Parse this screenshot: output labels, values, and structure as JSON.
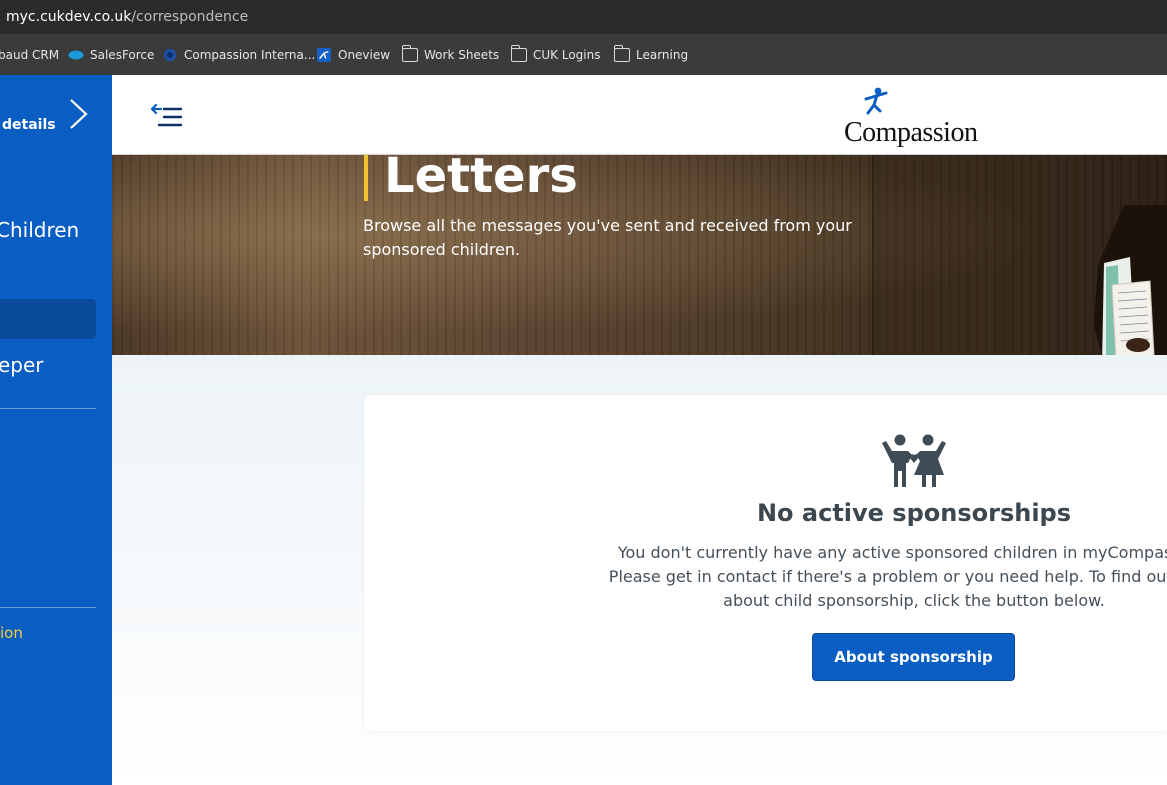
{
  "browser": {
    "url_host": "myc.cukdev.co.uk",
    "url_path": "/correspondence",
    "bookmarks": [
      {
        "label": "baud CRM",
        "icon": "none"
      },
      {
        "label": "SalesForce",
        "icon": "salesforce-icon"
      },
      {
        "label": "Compassion Interna...",
        "icon": "compassion-circle-icon"
      },
      {
        "label": "Oneview",
        "icon": "oneview-icon"
      },
      {
        "label": "Work Sheets",
        "icon": "folder-icon"
      },
      {
        "label": "CUK Logins",
        "icon": "folder-icon"
      },
      {
        "label": "Learning",
        "icon": "folder-icon"
      }
    ]
  },
  "sidebar": {
    "details_label": "details",
    "children_label": "Children",
    "keeper_label": "eper",
    "yellow_label": "ion"
  },
  "header": {
    "logo_text": "Compassion"
  },
  "hero": {
    "title": "Letters",
    "subtitle": "Browse all the messages you've sent and received from your sponsored children."
  },
  "card": {
    "title": "No active sponsorships",
    "text_line1": "You don't currently have any active sponsored children in myCompassion.",
    "text_line2": "Please get in contact if there's a problem or you need help. To find out more",
    "text_line3": "about child sponsorship, click the button below.",
    "button_label": "About sponsorship"
  },
  "colors": {
    "brand_blue": "#0a5dc2",
    "accent_yellow": "#f2c32c"
  }
}
